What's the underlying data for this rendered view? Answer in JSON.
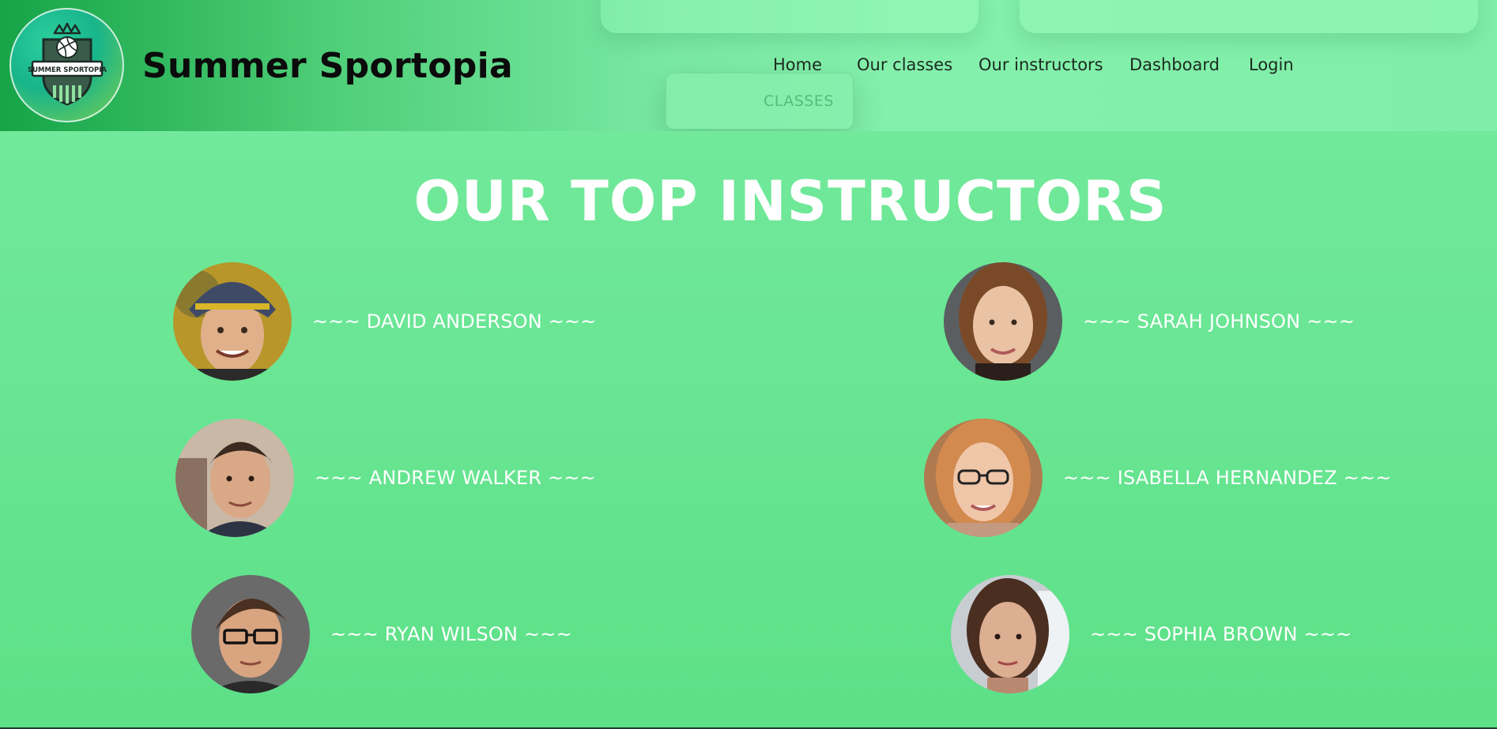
{
  "brand": {
    "name": "Summer Sportopia",
    "logo_text": "SUMMER SPORTOPIA"
  },
  "nav": {
    "items": [
      {
        "label": "Home"
      },
      {
        "label": "Our classes"
      },
      {
        "label": "Our instructors"
      },
      {
        "label": "Dashboard"
      },
      {
        "label": "Login"
      }
    ]
  },
  "ghost_button_label": "CLASSES",
  "section": {
    "title": "OUR TOP INSTRUCTORS"
  },
  "instructors": [
    {
      "name": "~~~ DAVID ANDERSON ~~~"
    },
    {
      "name": "~~~ SARAH JOHNSON ~~~"
    },
    {
      "name": "~~~ ANDREW WALKER ~~~"
    },
    {
      "name": "~~~ ISABELLA HERNANDEZ ~~~"
    },
    {
      "name": "~~~ RYAN WILSON ~~~"
    },
    {
      "name": "~~~ SOPHIA BROWN ~~~"
    }
  ],
  "colors": {
    "header_start": "#16a447",
    "header_end": "#80eea8",
    "page_background": "#6ee596",
    "title_text": "#ffffff"
  }
}
